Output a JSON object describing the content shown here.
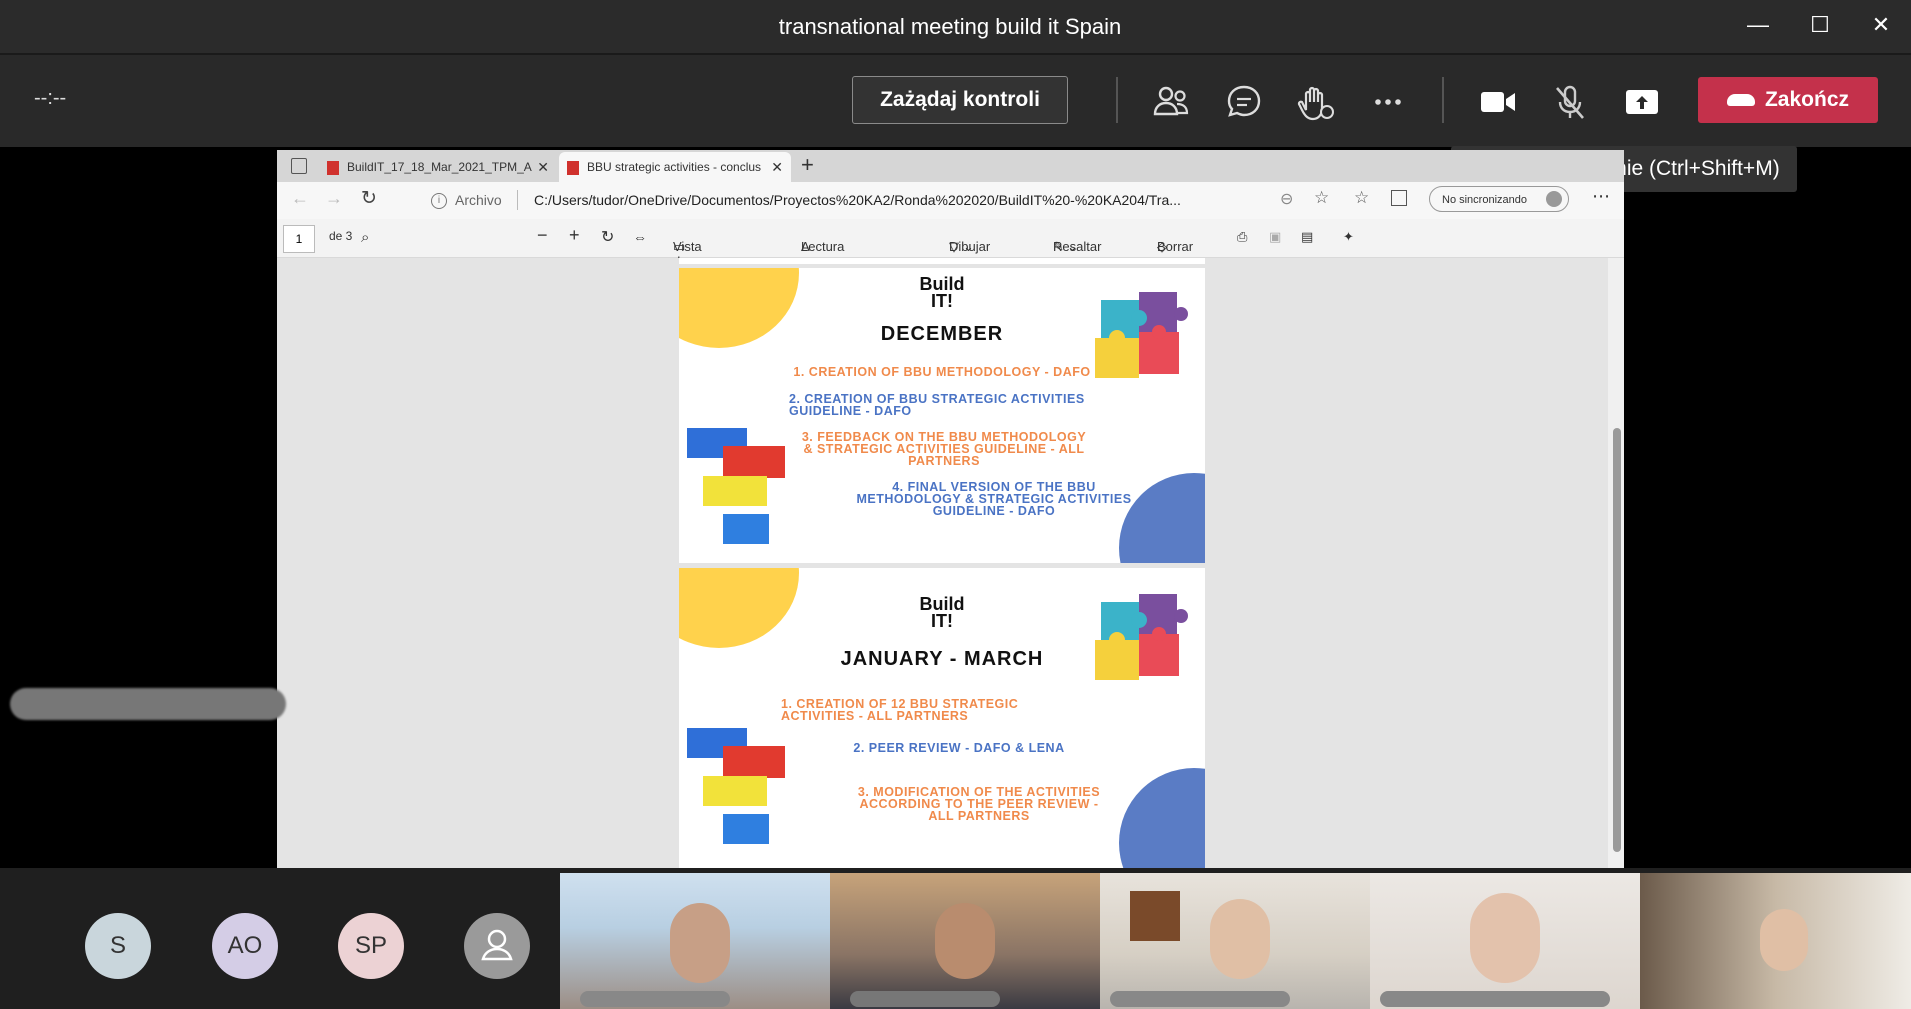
{
  "window": {
    "title": "transnational meeting build it Spain",
    "minimize": "—",
    "maximize": "☐",
    "close": "✕"
  },
  "meeting_toolbar": {
    "timer": "--:--",
    "request_control_label": "Zażądaj kontroli",
    "end_label": "Zakończ",
    "tooltip": "Wyłącz wyciszenie (Ctrl+Shift+M)",
    "icons": [
      "participants-icon",
      "chat-icon",
      "reactions-icon",
      "more-icon",
      "camera-icon",
      "mic-muted-icon",
      "share-icon"
    ]
  },
  "browser": {
    "tabs": [
      {
        "label": "BuildIT_17_18_Mar_2021_TPM_A"
      },
      {
        "label": "BBU strategic activities - conclus"
      }
    ],
    "address": {
      "archive_label": "Archivo",
      "url": "C:/Users/tudor/OneDrive/Documentos/Proyectos%20KA2/Ronda%202020/BuildIT%20-%20KA204/Tra...",
      "sync_label": "No sincronizando"
    },
    "pdf_toolbar": {
      "page_number": "1",
      "page_total": "de 3",
      "page_view": "Vista de página",
      "read_aloud": "Lectura en voz alta",
      "draw": "Dibujar",
      "highlight": "Resaltar",
      "erase": "Borrar"
    }
  },
  "slides": [
    {
      "logo": "Build IT!",
      "title": "DECEMBER",
      "items": [
        "1. CREATION OF BBU METHODOLOGY - DAFO",
        "2. CREATION OF BBU STRATEGIC ACTIVITIES GUIDELINE - DAFO",
        "3. FEEDBACK ON THE BBU  METHODOLOGY & STRATEGIC ACTIVITIES GUIDELINE - ALL PARTNERS",
        "4. FINAL VERSION OF THE BBU  METHODOLOGY & STRATEGIC ACTIVITIES GUIDELINE - DAFO"
      ]
    },
    {
      "logo": "Build IT!",
      "title": "JANUARY - MARCH",
      "items": [
        "1. CREATION OF 12 BBU STRATEGIC ACTIVITIES - ALL PARTNERS",
        "2. PEER REVIEW - DAFO & LENA",
        "3. MODIFICATION  OF THE ACTIVITIES ACCORDING TO THE PEER REVIEW - ALL PARTNERS"
      ]
    }
  ],
  "participants": {
    "avatars": [
      {
        "initials": "S",
        "color": "#c9d6dc"
      },
      {
        "initials": "AO",
        "color": "#d4cde6"
      },
      {
        "initials": "SP",
        "color": "#ecd2d4"
      },
      {
        "initials": "",
        "color": "#9a9a9a"
      }
    ],
    "videos": 5
  }
}
